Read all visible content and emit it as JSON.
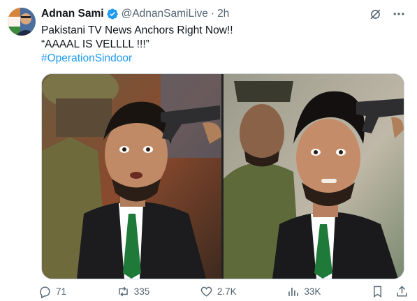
{
  "author": {
    "name": "Adnan Sami",
    "handle": "@AdnanSamiLive",
    "separator": "·",
    "time": "2h",
    "verified_icon": "verified-badge-icon",
    "avatar_icon": "avatar-image"
  },
  "tweet": {
    "line1": "Pakistani TV News Anchors Right Now!!",
    "line2": "“AAAAL IS VELLLL !!!”",
    "hashtag": "#OperationSindoor"
  },
  "media": {
    "left_image": "anchor-with-gun-image-1",
    "right_image": "anchor-with-gun-image-2"
  },
  "actions": {
    "replies": "71",
    "reposts": "335",
    "likes": "2.7K",
    "views": "33K"
  },
  "icons": {
    "grok": "grok-icon",
    "more": "more-options-icon",
    "reply": "reply-icon",
    "repost": "repost-icon",
    "like": "like-icon",
    "views": "views-icon",
    "bookmark": "bookmark-icon",
    "share": "share-icon"
  },
  "colors": {
    "accent": "#1d9bf0",
    "muted": "#536471",
    "text": "#0f1419"
  }
}
